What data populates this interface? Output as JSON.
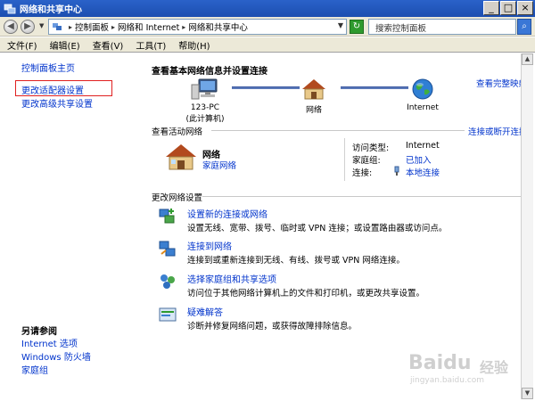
{
  "window": {
    "title": "网络和共享中心"
  },
  "window_controls": {
    "minimize": "_",
    "maximize": "□",
    "close": "×"
  },
  "address": {
    "crumbs": [
      "控制面板",
      "网络和 Internet",
      "网络和共享中心"
    ],
    "search_placeholder": "搜索控制面板"
  },
  "menu": [
    "文件(F)",
    "编辑(E)",
    "查看(V)",
    "工具(T)",
    "帮助(H)"
  ],
  "sidebar": {
    "home_link": "控制面板主页",
    "links": [
      "更改适配器设置",
      "更改高级共享设置"
    ],
    "see_also_heading": "另请参阅",
    "see_also": [
      "Internet 选项",
      "Windows 防火墙",
      "家庭组"
    ]
  },
  "main": {
    "title": "查看基本网络信息并设置连接",
    "full_map": "查看完整映射",
    "nodes": [
      {
        "name": "123-PC",
        "sub": "(此计算机)"
      },
      {
        "name": "网络",
        "sub": ""
      },
      {
        "name": "Internet",
        "sub": ""
      }
    ],
    "active_section": "查看活动网络",
    "connect_link": "连接或断开连接",
    "active_network": {
      "name": "网络",
      "type": "家庭网络",
      "props": [
        {
          "label": "访问类型:",
          "value": "Internet",
          "is_link": false
        },
        {
          "label": "家庭组:",
          "value": "已加入",
          "is_link": true
        },
        {
          "label": "连接:",
          "value": "本地连接",
          "is_link": true
        }
      ]
    },
    "change_section": "更改网络设置",
    "tasks": [
      {
        "title": "设置新的连接或网络",
        "desc": "设置无线、宽带、拨号、临时或 VPN 连接；或设置路由器或访问点。"
      },
      {
        "title": "连接到网络",
        "desc": "连接到或重新连接到无线、有线、拨号或 VPN 网络连接。"
      },
      {
        "title": "选择家庭组和共享选项",
        "desc": "访问位于其他网络计算机上的文件和打印机，或更改共享设置。"
      },
      {
        "title": "疑难解答",
        "desc": "诊断并修复网络问题，或获得故障排除信息。"
      }
    ]
  },
  "watermark": {
    "brand": "Baidu",
    "sub": "经验",
    "url": "jingyan.baidu.com"
  },
  "colors": {
    "link": "#0033cc",
    "titlebar": "#2a62c9",
    "highlight_box": "#e02020"
  }
}
